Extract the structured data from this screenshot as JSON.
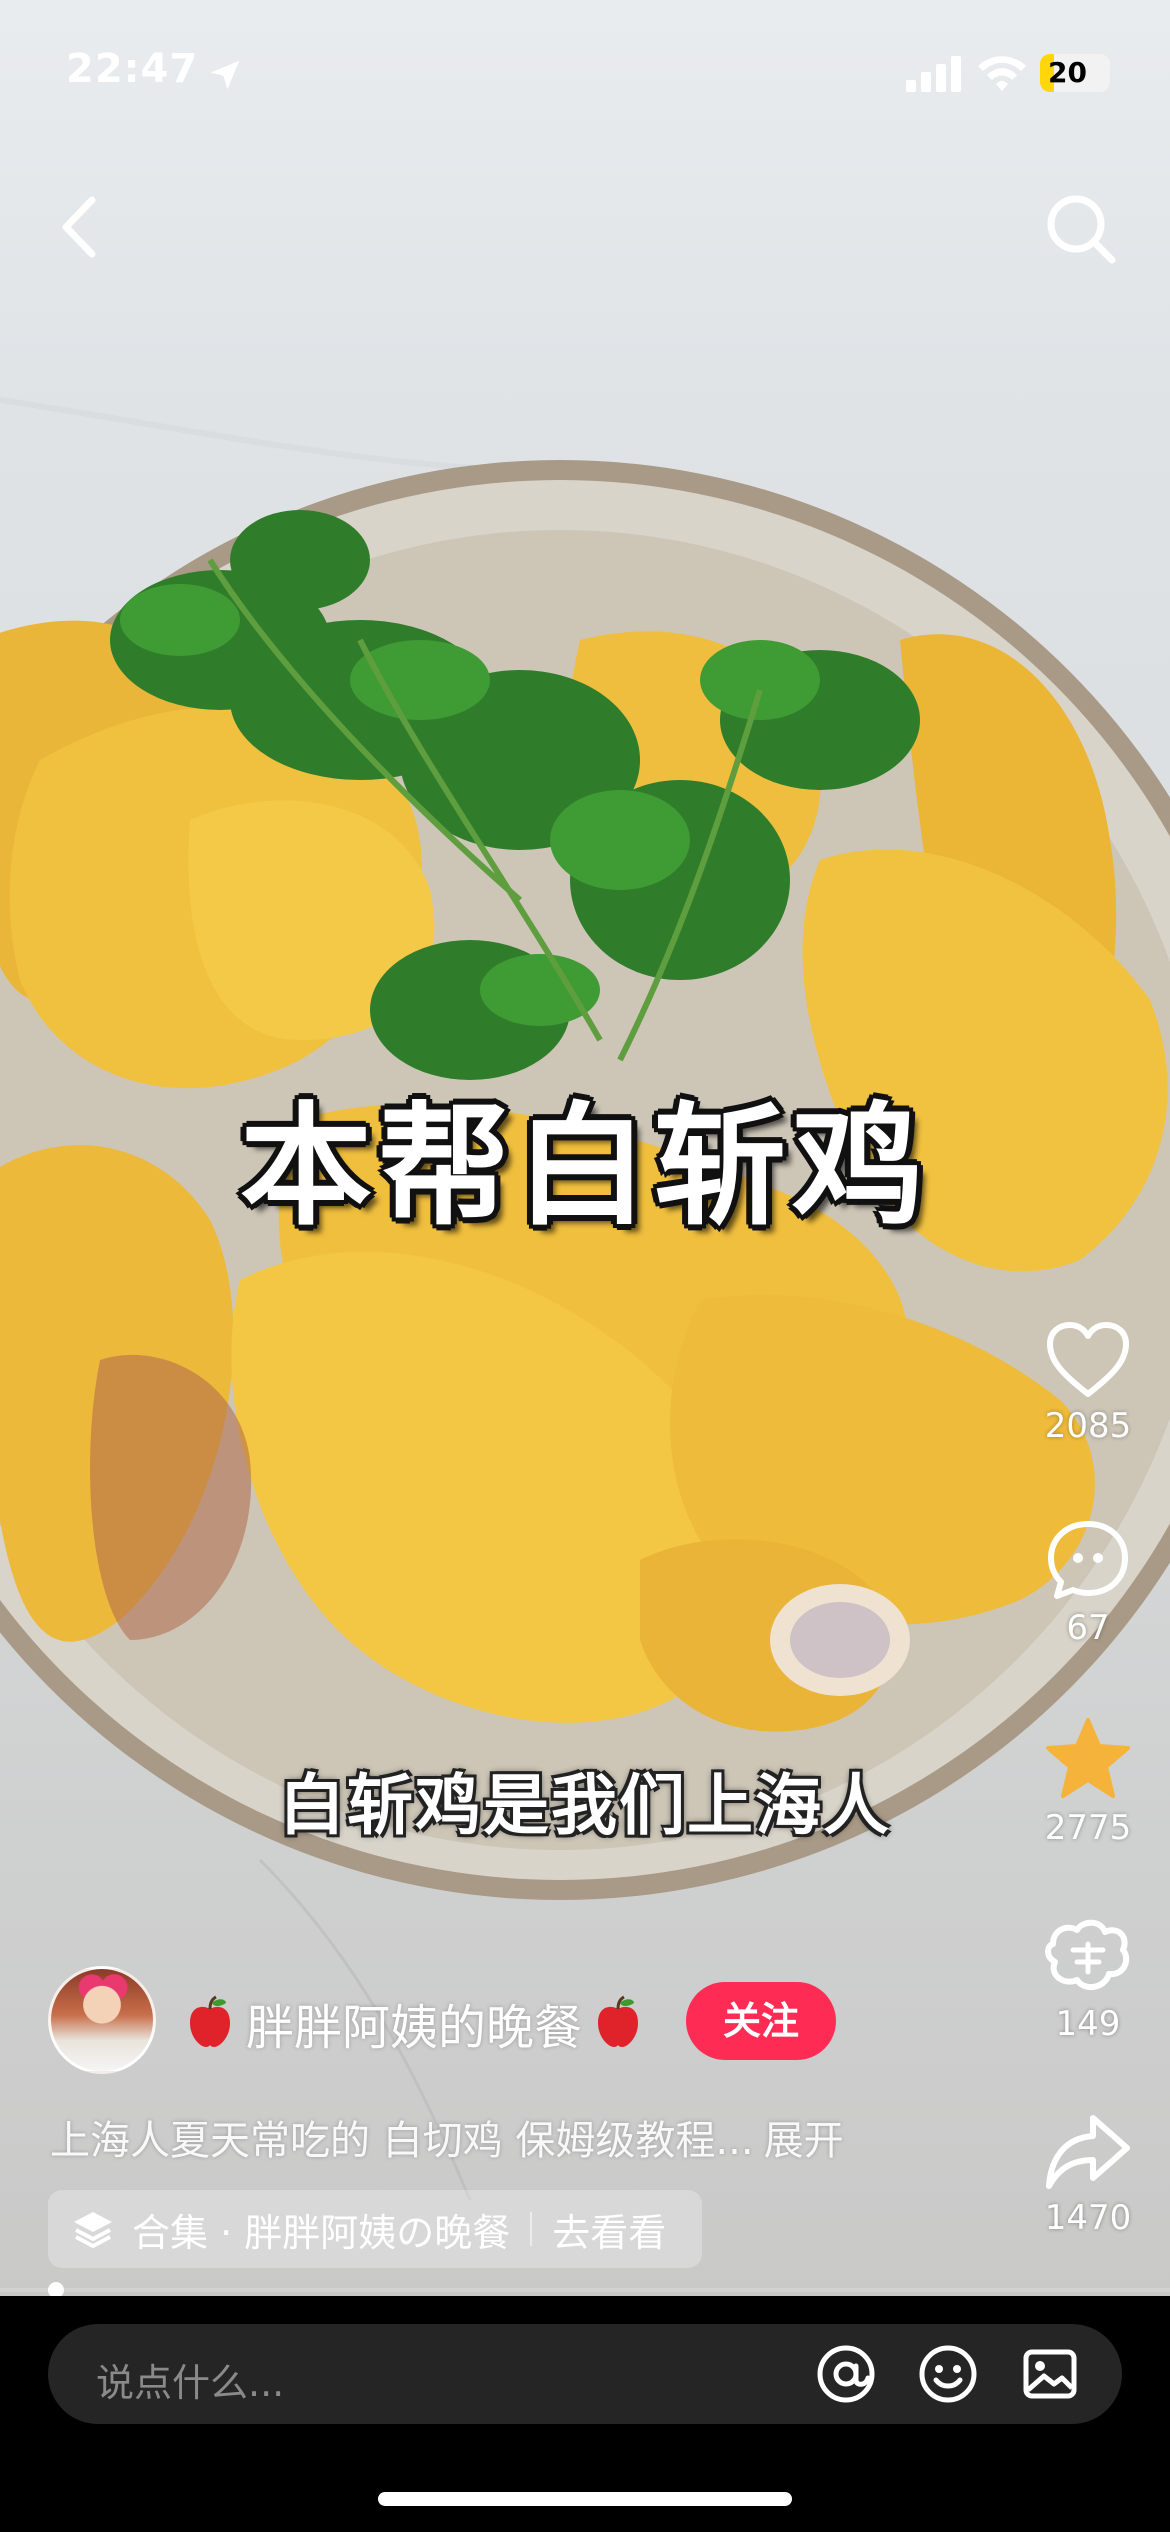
{
  "status_bar": {
    "time": "22:47",
    "battery": "20"
  },
  "video": {
    "title": "本帮白斩鸡",
    "subtitle": "白斩鸡是我们上海人"
  },
  "actions": {
    "likes": "2085",
    "comments": "67",
    "collects": "2775",
    "gifts": "149",
    "shares": "1470"
  },
  "author": {
    "name": "胖胖阿姨的晚餐",
    "follow_label": "关注"
  },
  "description": {
    "text": "上海人夏天常吃的 白切鸡 保姆级教程...",
    "expand_label": "展开"
  },
  "collection": {
    "name": "合集 · 胖胖阿姨の晚餐",
    "link_label": "去看看"
  },
  "comment_bar": {
    "placeholder": "说点什么..."
  },
  "colors": {
    "accent": "#fe2c55",
    "collect_star": "#f5b33b",
    "battery": "#ffd60a"
  },
  "icons": [
    "location-arrow-icon",
    "signal-icon",
    "wifi-icon",
    "back-icon",
    "search-icon",
    "heart-icon",
    "comment-icon",
    "star-icon",
    "gift-icon",
    "share-icon",
    "apple-icon",
    "layers-icon",
    "at-icon",
    "emoji-icon",
    "image-icon"
  ]
}
